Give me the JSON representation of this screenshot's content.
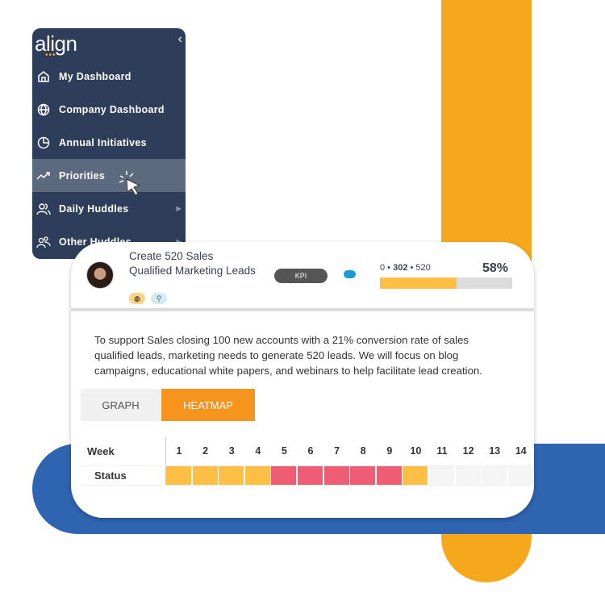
{
  "sidebar": {
    "logo": "align",
    "items": [
      {
        "label": "My Dashboard",
        "icon": "home-icon"
      },
      {
        "label": "Company Dashboard",
        "icon": "globe-icon"
      },
      {
        "label": "Annual Initiatives",
        "icon": "pie-chart-icon"
      },
      {
        "label": "Priorities",
        "icon": "trending-up-icon",
        "active": true
      },
      {
        "label": "Daily Huddles",
        "icon": "users-icon",
        "submenu": true
      },
      {
        "label": "Other Huddles",
        "icon": "group-icon",
        "submenu": true
      }
    ]
  },
  "priority": {
    "title": "Create 520 Sales Qualified Marketing Leads",
    "badge": "KPI",
    "progress_start": "0",
    "progress_current": "302",
    "progress_target": "520",
    "percent_label": "58%",
    "percent": 58,
    "description": "To support Sales closing 100 new accounts with a 21% conversion rate of sales qualified leads, marketing needs to generate 520 leads. We will focus on blog campaigns, educational white papers, and webinars to help facilitate lead creation."
  },
  "tabs": {
    "graph": "GRAPH",
    "heatmap": "HEATMAP",
    "active": "heatmap"
  },
  "heatmap": {
    "week_label": "Week",
    "status_label": "Status",
    "weeks": [
      "1",
      "2",
      "3",
      "4",
      "5",
      "6",
      "7",
      "8",
      "9",
      "10",
      "11",
      "12",
      "13",
      "14"
    ],
    "status": [
      "yellow",
      "yellow",
      "yellow",
      "yellow",
      "red",
      "red",
      "red",
      "red",
      "red",
      "yellow",
      "none",
      "none",
      "none",
      "none"
    ]
  },
  "colors": {
    "yellow": "#ffbf45",
    "red": "#ee5d73",
    "none": "#f4f5f4",
    "accent": "#f7941d",
    "sidebar": "#2e3e5a"
  }
}
